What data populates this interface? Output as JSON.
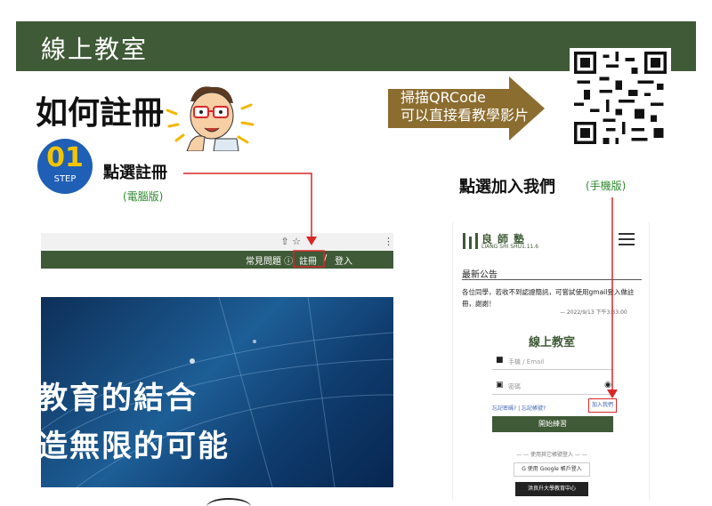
{
  "banner": {
    "title": "線上教室"
  },
  "header": {
    "how_title": "如何註冊",
    "step_number": "01",
    "step_label": "STEP"
  },
  "pc": {
    "click_register": "點選註冊",
    "note": "(電腦版)",
    "browser_icons": "⇧  ☆",
    "browser_menu": "⋮",
    "nav_faq": "常見問題 ⓘ",
    "nav_register": "註冊",
    "nav_sep": "/",
    "nav_login": "登入",
    "hero_line1": "教育的結合",
    "hero_line2": "造無限的可能"
  },
  "qr_callout": {
    "line1": "掃描QRCode",
    "line2": "可以直接看教學影片"
  },
  "mobile": {
    "click_join": "點選加入我們",
    "note": "(手機版)",
    "logo_cn": "良師塾",
    "logo_en": "LIANG SHI SHU1.11.6",
    "news_title": "最新公告",
    "news_body": "各位同學，若收不到認證簡訊，可嘗試使用gmail登入做註冊，謝謝！",
    "news_date": "— 2022/9/13 下午3:33:00",
    "form_title": "線上教室",
    "phone_placeholder": "手機 / Email",
    "password_placeholder": "密碼",
    "forgot_link": "忘記密碼? | 忘記帳號?",
    "join_link": "加入我們",
    "start_button": "開始練習",
    "other_login": "— — 使用其它帳號登入 — —",
    "google_button": "G  使用 Google 帳戶登入",
    "center_button": "洪良升大學教育中心"
  },
  "colors": {
    "brand_green": "#3f5a36",
    "callout_brown": "#8b6d2f",
    "step_blue": "#1f5fb5",
    "step_yellow": "#f5c400",
    "highlight_red": "#d62828",
    "note_green": "#2f8a2f"
  }
}
